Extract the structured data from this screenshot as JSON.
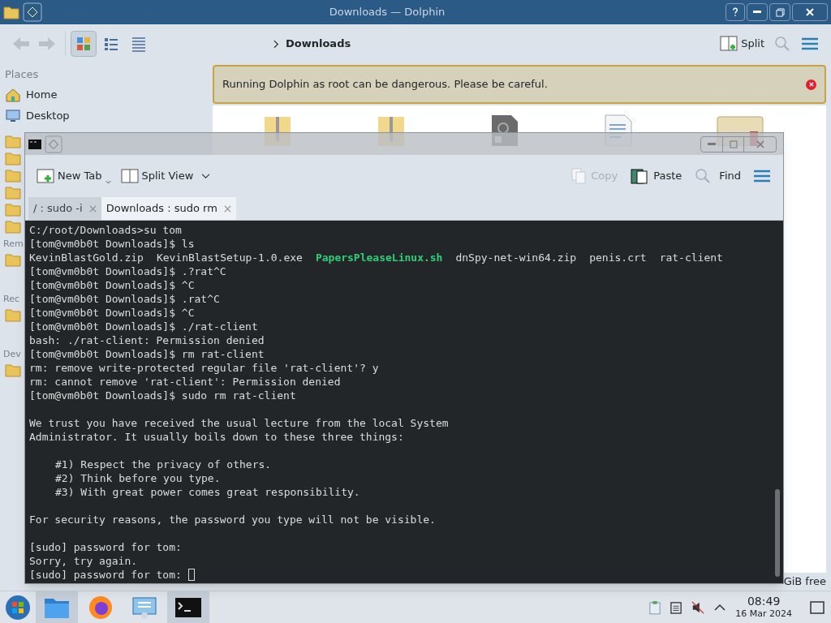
{
  "dolphin": {
    "title": "Downloads — Dolphin",
    "view_modes": [
      {
        "kind": "icons",
        "selected": true
      },
      {
        "kind": "compact",
        "selected": false
      },
      {
        "kind": "details",
        "selected": false
      }
    ],
    "breadcrumb": "Downloads",
    "split_label": "Split",
    "warning": "Running Dolphin as root can be dangerous. Please be careful.",
    "places_header": "Places",
    "places": [
      {
        "label": "Home",
        "kind": "home"
      },
      {
        "label": "Desktop",
        "kind": "desktop"
      }
    ],
    "section_headers": [
      "Rem",
      "Rec",
      "Dev"
    ],
    "files": [
      {
        "kind": "archive"
      },
      {
        "kind": "archive"
      },
      {
        "kind": "executable"
      },
      {
        "kind": "document"
      },
      {
        "kind": "certificate"
      }
    ],
    "free_space": "GiB free"
  },
  "terminal": {
    "toolbar": {
      "new_tab": "New Tab",
      "split_view": "Split View",
      "copy": {
        "label": "Copy",
        "disabled": true
      },
      "paste": "Paste",
      "find": "Find"
    },
    "tabs": [
      {
        "label": "/ : sudo -i",
        "selected": false
      },
      {
        "label": "Downloads : sudo rm",
        "selected": true
      }
    ],
    "lines": [
      {
        "kind": "text",
        "text": "C:/root/Downloads>su tom"
      },
      {
        "kind": "text",
        "text": "[tom@vm0b0t Downloads]$ ls"
      },
      {
        "kind": "listing",
        "items": [
          {
            "text": "KevinBlastGold.zip",
            "color": "#dcdcdc"
          },
          {
            "text": "KevinBlastSetup-1.0.exe",
            "color": "#dcdcdc"
          },
          {
            "text": "PapersPleaseLinux.sh",
            "color": "#2fcf7a"
          },
          {
            "text": "dnSpy-net-win64.zip",
            "color": "#dcdcdc"
          },
          {
            "text": "penis.crt",
            "color": "#dcdcdc"
          },
          {
            "text": "rat-client",
            "color": "#dcdcdc"
          }
        ]
      },
      {
        "kind": "text",
        "text": "[tom@vm0b0t Downloads]$ .?rat^C"
      },
      {
        "kind": "text",
        "text": "[tom@vm0b0t Downloads]$ ^C"
      },
      {
        "kind": "text",
        "text": "[tom@vm0b0t Downloads]$ .rat^C"
      },
      {
        "kind": "text",
        "text": "[tom@vm0b0t Downloads]$ ^C"
      },
      {
        "kind": "text",
        "text": "[tom@vm0b0t Downloads]$ ./rat-client"
      },
      {
        "kind": "text",
        "text": "bash: ./rat-client: Permission denied"
      },
      {
        "kind": "text",
        "text": "[tom@vm0b0t Downloads]$ rm rat-client"
      },
      {
        "kind": "text",
        "text": "rm: remove write-protected regular file 'rat-client'? y"
      },
      {
        "kind": "text",
        "text": "rm: cannot remove 'rat-client': Permission denied"
      },
      {
        "kind": "text",
        "text": "[tom@vm0b0t Downloads]$ sudo rm rat-client"
      },
      {
        "kind": "blank"
      },
      {
        "kind": "text",
        "text": "We trust you have received the usual lecture from the local System"
      },
      {
        "kind": "text",
        "text": "Administrator. It usually boils down to these three things:"
      },
      {
        "kind": "blank"
      },
      {
        "kind": "indented",
        "text": "#1) Respect the privacy of others."
      },
      {
        "kind": "indented",
        "text": "#2) Think before you type."
      },
      {
        "kind": "indented",
        "text": "#3) With great power comes great responsibility."
      },
      {
        "kind": "blank"
      },
      {
        "kind": "text",
        "text": "For security reasons, the password you type will not be visible."
      },
      {
        "kind": "blank"
      },
      {
        "kind": "text",
        "text": "[sudo] password for tom:"
      },
      {
        "kind": "text",
        "text": "Sorry, try again."
      },
      {
        "kind": "prompt",
        "text": "[sudo] password for tom:"
      }
    ]
  },
  "taskbar": {
    "apps": [
      {
        "kind": "files",
        "selected": true
      },
      {
        "kind": "browser",
        "selected": false
      },
      {
        "kind": "settings",
        "selected": false
      },
      {
        "kind": "terminal",
        "selected": true
      }
    ],
    "time": "08:49",
    "date": "16 Mar 2024"
  }
}
